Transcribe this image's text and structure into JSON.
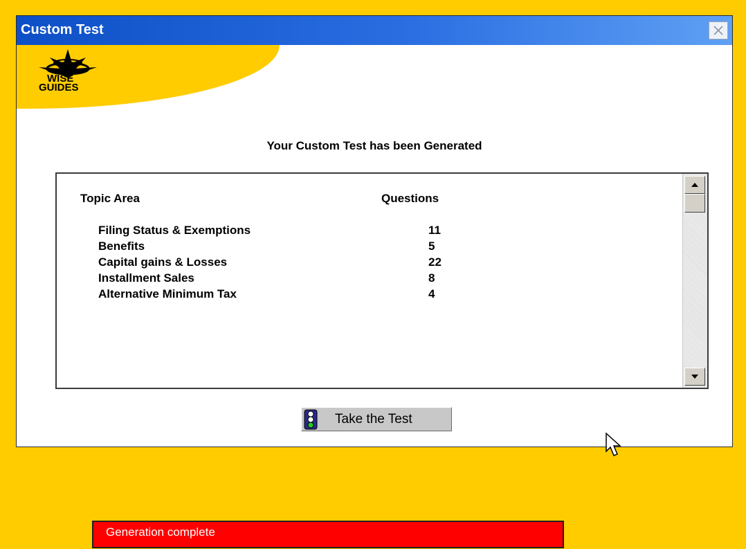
{
  "window": {
    "title": "Custom Test",
    "close_icon": "close-icon"
  },
  "logo": {
    "line1": "WISE",
    "line2": "GUIDES",
    "icon": "star-eye-logo",
    "brand_color": "#ffcc00"
  },
  "heading": "Your Custom Test has been Generated",
  "table": {
    "columns": [
      "Topic Area",
      "Questions"
    ],
    "rows": [
      {
        "topic": "Filing Status & Exemptions",
        "questions": "11"
      },
      {
        "topic": "Benefits",
        "questions": "5"
      },
      {
        "topic": "Capital gains & Losses",
        "questions": "22"
      },
      {
        "topic": "Installment Sales",
        "questions": "8"
      },
      {
        "topic": "Alternative Minimum Tax",
        "questions": "4"
      }
    ]
  },
  "button": {
    "label": "Take the Test",
    "icon": "traffic-light-icon"
  },
  "status": {
    "text": "Generation complete",
    "color": "#ff0000"
  },
  "colors": {
    "background": "#ffcc00",
    "titlebar": "#0d4fc6"
  }
}
